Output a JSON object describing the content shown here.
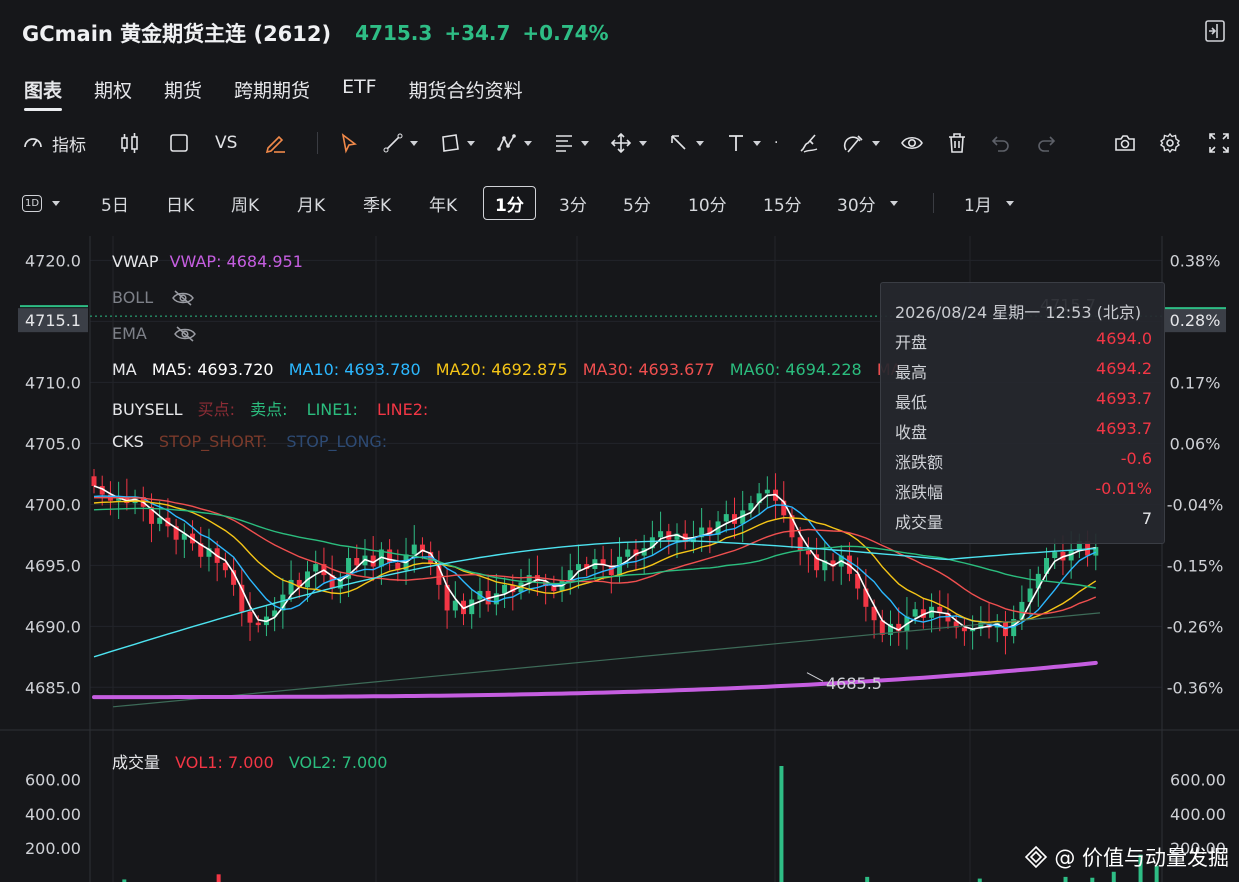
{
  "header": {
    "title": "GCmain 黄金期货主连 (2612)",
    "price": "4715.3",
    "change": "+34.7",
    "change_pct": "+0.74%"
  },
  "tabs": [
    "图表",
    "期权",
    "期货",
    "跨期期货",
    "ETF",
    "期货合约资料"
  ],
  "toolbar": {
    "indicators_label": "指标",
    "vs_label": "VS"
  },
  "periods": {
    "interval_icon": "1D",
    "items": [
      "5日",
      "日K",
      "周K",
      "月K",
      "季K",
      "年K",
      "1分",
      "3分",
      "5分",
      "10分",
      "15分",
      "30分"
    ],
    "active": "1分",
    "range": "1月"
  },
  "indicators": {
    "vwap_name": "VWAP",
    "vwap_value": "VWAP: 4684.951",
    "boll": "BOLL",
    "ema": "EMA",
    "ma_name": "MA",
    "ma5": "MA5: 4693.720",
    "ma10": "MA10: 4693.780",
    "ma20": "MA20: 4692.875",
    "ma30": "MA30: 4693.677",
    "ma60": "MA60: 4694.228",
    "ma_hidden": "MA",
    "buysell": "BUYSELL",
    "buy_point": "买点:",
    "sell_point": "卖点:",
    "line1": "LINE1:",
    "line2": "LINE2:",
    "cks": "CKS",
    "stop_short": "STOP_SHORT:",
    "stop_long": "STOP_LONG:"
  },
  "tooltip": {
    "date": "2026/08/24 星期一 12:53 (北京)",
    "rows": [
      {
        "k": "开盘",
        "v": "4694.0"
      },
      {
        "k": "最高",
        "v": "4694.2"
      },
      {
        "k": "最低",
        "v": "4693.7"
      },
      {
        "k": "收盘",
        "v": "4693.7"
      },
      {
        "k": "涨跌额",
        "v": "-0.6"
      },
      {
        "k": "涨跌幅",
        "v": "-0.01%"
      },
      {
        "k": "成交量",
        "v": "7"
      }
    ]
  },
  "volume_legend": {
    "name": "成交量",
    "vol1": "VOL1: 7.000",
    "vol2": "VOL2: 7.000"
  },
  "current_price_tag": "4715.1",
  "current_pct_tag": "0.28%",
  "low_marker": "4685.5",
  "high_marker_partial": "4715.7",
  "watermark": "@ 价值与动量发掘",
  "colors": {
    "up": "#2ebd85",
    "down": "#f23645",
    "vwap": "#c55ee0",
    "ma5": "#ffffff",
    "ma10": "#2cb8ff",
    "ma20": "#f5c517",
    "ma30": "#ef4f4f",
    "ma60": "#2bbd7e",
    "ma_long": "#4de3f0",
    "ma_trend": "#3d6b58"
  },
  "chart_data": {
    "type": "candlestick",
    "price_axis": {
      "ticks": [
        4720.0,
        4715.0,
        4710.0,
        4705.0,
        4700.0,
        4695.0,
        4690.0,
        4685.0
      ],
      "labels": [
        "4720.0",
        "4715.1",
        "4710.0",
        "4705.0",
        "4700.0",
        "4695.0",
        "4690.0",
        "4685.0"
      ],
      "ylim": [
        4681.5,
        4722
      ]
    },
    "pct_axis": {
      "labels": [
        "0.38%",
        "0.28%",
        "0.17%",
        "0.06%",
        "-0.04%",
        "-0.15%",
        "-0.26%",
        "-0.36%"
      ]
    },
    "volume_axis": {
      "labels": [
        "600.00",
        "400.00",
        "200.00"
      ],
      "ylim": [
        0,
        680
      ]
    },
    "candles_close": [
      4701.5,
      4700.8,
      4700.3,
      4700.5,
      4700.1,
      4700.6,
      4699.8,
      4698.4,
      4698.9,
      4698.2,
      4697.1,
      4697.6,
      4696.8,
      4695.7,
      4696.4,
      4695.2,
      4694.6,
      4693.4,
      4691.2,
      4690.3,
      4690.1,
      4690.8,
      4691.3,
      4692.6,
      4693.8,
      4693.2,
      4694.5,
      4695.1,
      4694.2,
      4693.1,
      4693.9,
      4695.6,
      4695.0,
      4695.8,
      4694.9,
      4696.3,
      4695.2,
      4694.6,
      4695.9,
      4696.7,
      4696.1,
      4695.1,
      4693.4,
      4691.3,
      4692.1,
      4691.0,
      4692.2,
      4692.9,
      4691.8,
      4692.7,
      4693.4,
      4692.8,
      4693.6,
      4694.2,
      4693.7,
      4693.3,
      4692.9,
      4693.8,
      4694.6,
      4695.1,
      4694.7,
      4695.5,
      4695.0,
      4694.2,
      4695.7,
      4696.3,
      4695.8,
      4696.4,
      4697.3,
      4697.8,
      4697.1,
      4697.6,
      4696.9,
      4697.3,
      4698.1,
      4697.5,
      4698.6,
      4699.2,
      4698.4,
      4699.5,
      4700.1,
      4700.9,
      4701.2,
      4700.3,
      4699.1,
      4697.3,
      4696.2,
      4695.9,
      4694.6,
      4695.4,
      4694.9,
      4695.8,
      4694.3,
      4693.1,
      4691.6,
      4690.5,
      4689.3,
      4690.2,
      4689.6,
      4690.8,
      4691.4,
      4690.7,
      4691.6,
      4691.1,
      4690.4,
      4689.9,
      4689.6,
      4689.8,
      4690.3,
      4689.9,
      4690.4,
      4689.2,
      4690.6,
      4692.0,
      4693.1,
      4694.3,
      4695.6,
      4696.1,
      4695.4,
      4696.2,
      4697.0,
      4695.8,
      4696.5
    ],
    "vwap": {
      "start": 4684.2,
      "end": 4687.0
    },
    "volume_bars": [
      {
        "x": 0.032,
        "v": 15
      },
      {
        "x": 0.12,
        "v": 45
      },
      {
        "x": 0.645,
        "v": 680
      },
      {
        "x": 0.725,
        "v": 30
      },
      {
        "x": 0.83,
        "v": 20
      },
      {
        "x": 0.91,
        "v": 30
      },
      {
        "x": 0.935,
        "v": 25
      },
      {
        "x": 0.955,
        "v": 60
      },
      {
        "x": 0.98,
        "v": 160
      },
      {
        "x": 0.995,
        "v": 95
      }
    ]
  }
}
